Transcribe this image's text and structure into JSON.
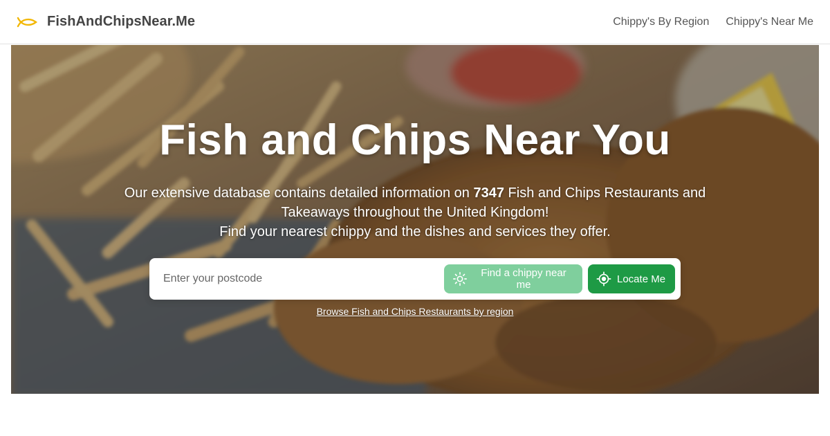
{
  "brand": {
    "name": "FishAndChipsNear.Me",
    "logo_icon": "fish-icon",
    "logo_color": "#f2b705"
  },
  "nav": {
    "links": [
      {
        "label": "Chippy's By Region"
      },
      {
        "label": "Chippy's Near Me"
      }
    ]
  },
  "hero": {
    "title": "Fish and Chips Near You",
    "desc_before": "Our extensive database contains detailed information on ",
    "restaurant_count": "7347",
    "desc_after": " Fish and Chips Restaurants and Takeaways throughout the United Kingdom!",
    "desc_line2": "Find your nearest chippy and the dishes and services they offer.",
    "background_image": "fish-and-chips-photo"
  },
  "search": {
    "placeholder": "Enter your postcode",
    "value": "",
    "find_button": {
      "label": "Find a chippy near me",
      "icon": "sun-icon",
      "color": "#7fcf9d"
    },
    "locate_button": {
      "label": "Locate Me",
      "icon": "crosshair-icon",
      "color": "#1e9a45"
    }
  },
  "browse_link": {
    "label": "Browse Fish and Chips Restaurants by region"
  }
}
